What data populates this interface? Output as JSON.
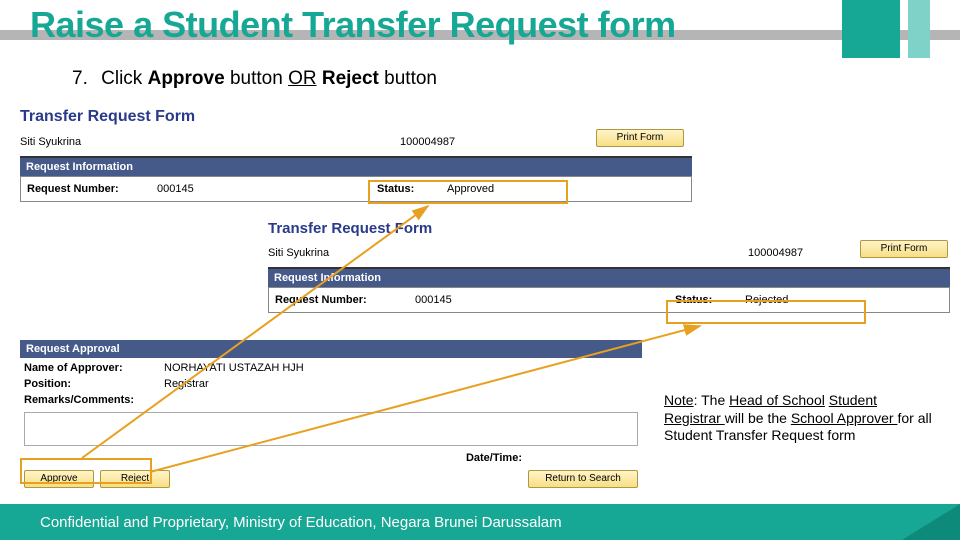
{
  "title": "Raise a Student Transfer Request form",
  "instruction": {
    "num": "7.",
    "pre": "Click ",
    "approve": "Approve",
    "mid1": " button ",
    "or": "OR",
    "sp": " ",
    "reject": "Reject",
    "post": " button"
  },
  "form1": {
    "title": "Transfer Request Form",
    "student_name": "Siti Syukrina",
    "student_id": "100004987",
    "print": "Print Form",
    "section": "Request Information",
    "reqnum_lbl": "Request Number:",
    "reqnum_val": "000145",
    "status_lbl": "Status:",
    "status_val": "Approved"
  },
  "form2": {
    "title": "Transfer Request Form",
    "student_name": "Siti Syukrina",
    "student_id": "100004987",
    "print": "Print Form",
    "section": "Request Information",
    "reqnum_lbl": "Request Number:",
    "reqnum_val": "000145",
    "status_lbl": "Status:",
    "status_val": "Rejected"
  },
  "approval": {
    "section": "Request Approval",
    "name_lbl": "Name of Approver:",
    "name_val": "NORHAYATI USTAZAH HJH",
    "position_lbl": "Position:",
    "position_val": "Registrar",
    "remarks_lbl": "Remarks/Comments:",
    "datetime_lbl": "Date/Time:",
    "approve_btn": "Approve",
    "reject_btn": "Reject",
    "return_btn": "Return to Search"
  },
  "note": {
    "prefix": "Note",
    "colon": ": The ",
    "head": "Head of School",
    "sp": " ",
    "reg": "Student Registrar ",
    "mid": "will be the ",
    "appr": "School Approver ",
    "tail": "for all Student Transfer Request form"
  },
  "footer": "Confidential and Proprietary, Ministry of Education, Negara Brunei Darussalam"
}
